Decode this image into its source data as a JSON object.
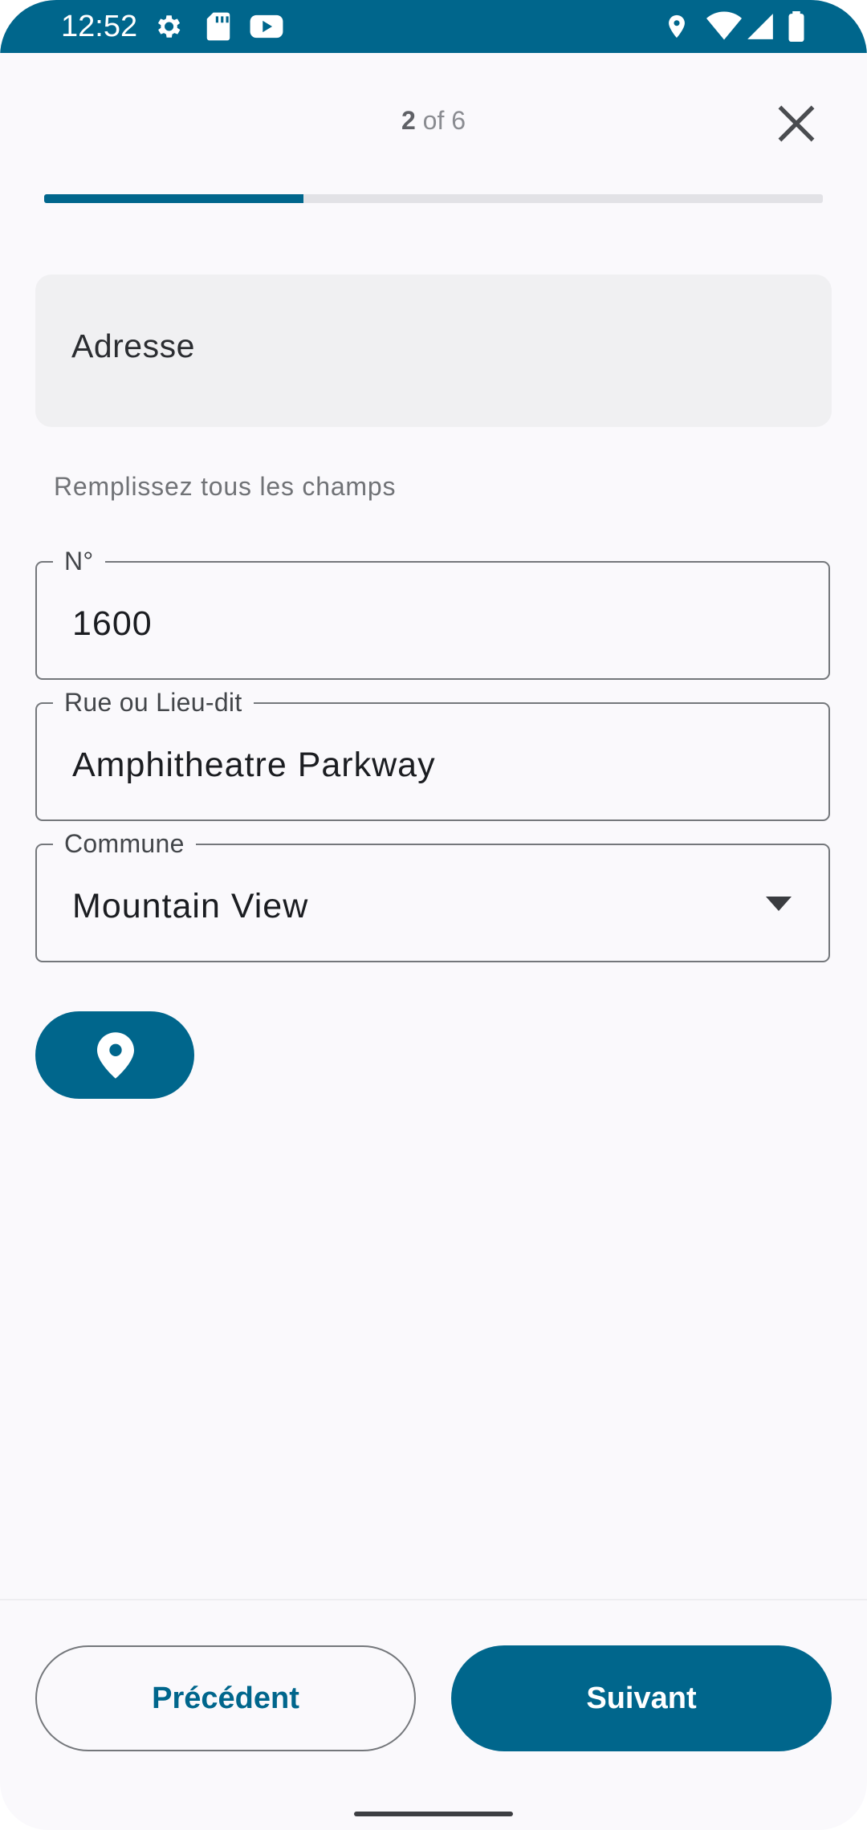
{
  "status_bar": {
    "time": "12:52",
    "left_icons": [
      "gear-icon",
      "sd-card-icon",
      "youtube-icon"
    ],
    "right_icons": [
      "location-icon",
      "wifi-icon",
      "signal-icon",
      "battery-icon"
    ],
    "background_color": "#00668c"
  },
  "header": {
    "step_current": "2",
    "step_total_text": "of 6",
    "progress_fraction": 0.333,
    "close_icon": "close-icon"
  },
  "section": {
    "title": "Adresse",
    "helper": "Remplissez tous les champs"
  },
  "fields": {
    "number": {
      "label": "N°",
      "value": "1600"
    },
    "street": {
      "label": "Rue ou Lieu-dit",
      "value": "Amphitheatre Parkway"
    },
    "commune": {
      "label": "Commune",
      "value": "Mountain View",
      "icon": "dropdown-arrow-icon"
    }
  },
  "location_button": {
    "icon": "map-pin-icon"
  },
  "footer": {
    "previous_label": "Précédent",
    "next_label": "Suivant"
  },
  "colors": {
    "accent": "#00668c",
    "background": "#faf9fc",
    "card": "#f0f0f2",
    "outline": "#74777b"
  }
}
